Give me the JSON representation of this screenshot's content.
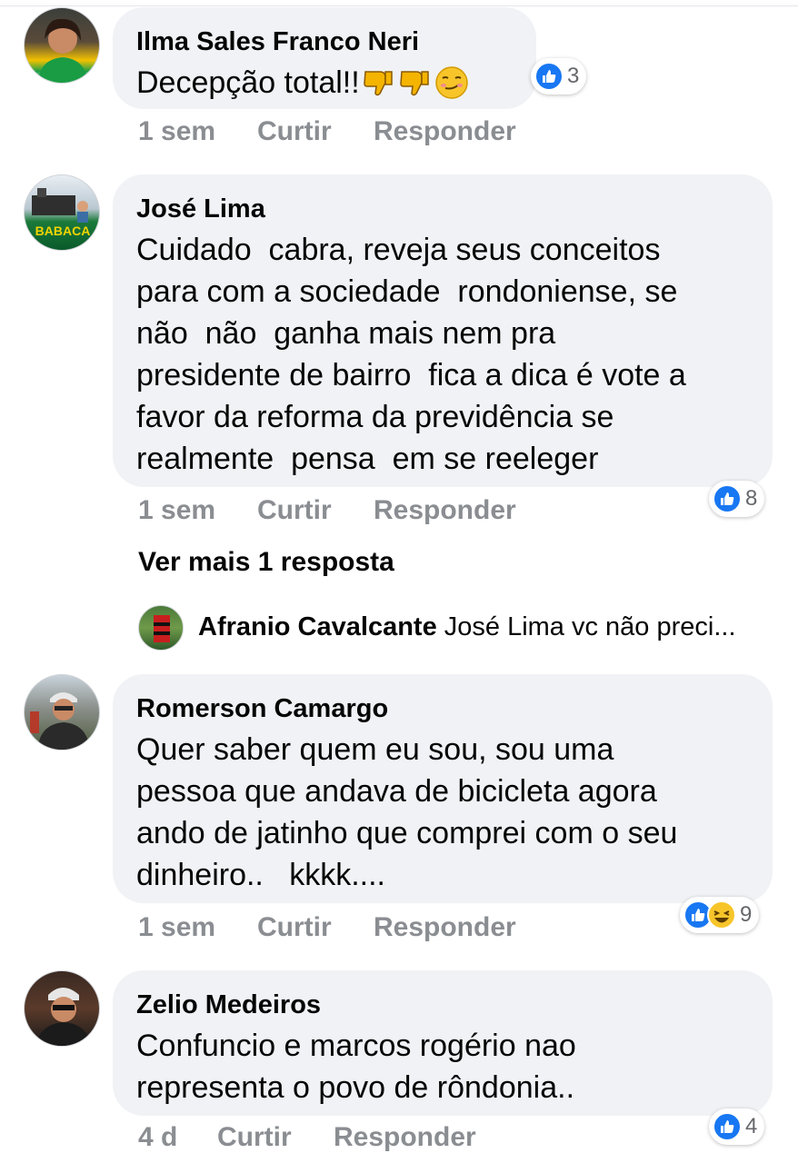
{
  "comments": [
    {
      "author": "Ilma Sales Franco Neri",
      "text": "Decepção total!!",
      "emoji": [
        "thumbs-down",
        "thumbs-down",
        "smirk-face"
      ],
      "time": "1 sem",
      "like_label": "Curtir",
      "reply_label": "Responder",
      "reactions": [
        "like"
      ],
      "reaction_count": "3"
    },
    {
      "author": "José Lima",
      "lines": [
        "Cuidado  cabra, reveja seus conceitos",
        "para com a sociedade  rondoniense, se",
        "não  não  ganha mais nem pra",
        "presidente de bairro  fica a dica é vote a",
        "favor da reforma da previdência se",
        "realmente  pensa  em se reeleger"
      ],
      "time": "1 sem",
      "like_label": "Curtir",
      "reply_label": "Responder",
      "reactions": [
        "like"
      ],
      "reaction_count": "8",
      "see_more": "Ver mais 1 resposta",
      "reply_preview": {
        "author": "Afranio Cavalcante",
        "text": "José Lima vc não preci..."
      }
    },
    {
      "author": "Romerson Camargo",
      "lines": [
        "Quer saber quem eu sou, sou uma",
        "pessoa que andava de bicicleta agora",
        "ando de jatinho que comprei com o seu",
        "dinheiro..   kkkk...."
      ],
      "time": "1 sem",
      "like_label": "Curtir",
      "reply_label": "Responder",
      "reactions": [
        "like",
        "haha"
      ],
      "reaction_count": "9"
    },
    {
      "author": "Zelio Medeiros",
      "lines": [
        "Confuncio e marcos rogério nao",
        "representa o povo de rôndonia.."
      ],
      "time": "4 d",
      "like_label": "Curtir",
      "reply_label": "Responder",
      "reactions": [
        "like"
      ],
      "reaction_count": "4"
    }
  ],
  "colors": {
    "bubble": "#f0f2f5",
    "meta_text": "#8a8d91",
    "like_blue": "#1877f2",
    "haha_yellow": "#f7c52a"
  }
}
